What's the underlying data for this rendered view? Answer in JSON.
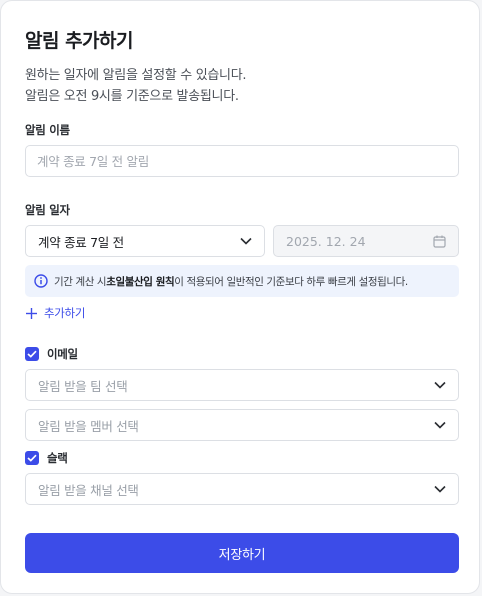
{
  "header": {
    "title": "알림 추가하기",
    "description_line1": "원하는 일자에 알림을 설정할 수 있습니다.",
    "description_line2": "알림은 오전 9시를 기준으로 발송됩니다."
  },
  "alert_name": {
    "label": "알림 이름",
    "placeholder": "계약 종료 7일 전 알림",
    "value": ""
  },
  "alert_date": {
    "label": "알림 일자",
    "selected": "계약 종료 7일 전",
    "date_value": "2025. 12. 24"
  },
  "info_banner": {
    "prefix": "기간 계산 시 ",
    "bold": "초일불산입 원칙",
    "suffix": "이 적용되어 일반적인 기준보다 하루 빠르게 설정됩니다."
  },
  "add_link": "추가하기",
  "email": {
    "label": "이메일",
    "checked": true,
    "team_placeholder": "알림 받을 팀 선택",
    "member_placeholder": "알림 받을 멤버 선택"
  },
  "slack": {
    "label": "슬랙",
    "checked": true,
    "channel_placeholder": "알림 받을 채널 선택"
  },
  "save_label": "저장하기",
  "colors": {
    "accent": "#3c4ce8",
    "info_bg": "#eef3fd"
  }
}
